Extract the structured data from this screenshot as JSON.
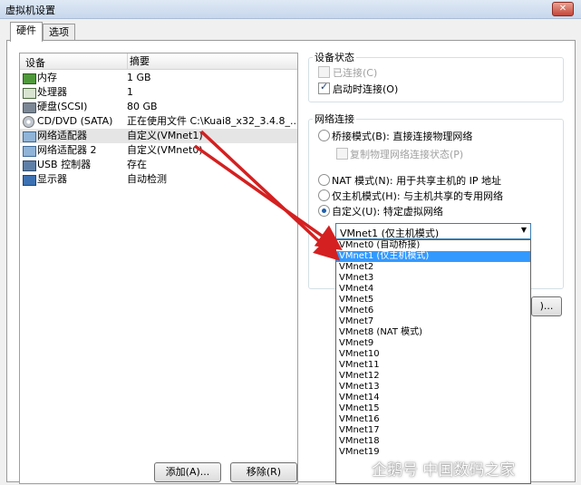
{
  "window": {
    "title": "虚拟机设置",
    "close_label": "✕"
  },
  "tabs": [
    {
      "label": "硬件"
    },
    {
      "label": "选项"
    }
  ],
  "device_list": {
    "col_device": "设备",
    "col_summary": "摘要",
    "rows": [
      {
        "icon": "memory-icon",
        "name": "内存",
        "summary": "1 GB"
      },
      {
        "icon": "processor-icon",
        "name": "处理器",
        "summary": "1"
      },
      {
        "icon": "hard-disk-icon",
        "name": "硬盘(SCSI)",
        "summary": "80 GB"
      },
      {
        "icon": "cd-dvd-icon",
        "name": "CD/DVD (SATA)",
        "summary": "正在使用文件 C:\\Kuai8_x32_3.4.8_..."
      },
      {
        "icon": "network-adapter-icon",
        "name": "网络适配器",
        "summary": "自定义(VMnet1)"
      },
      {
        "icon": "network-adapter-icon",
        "name": "网络适配器 2",
        "summary": "自定义(VMnet0)"
      },
      {
        "icon": "usb-icon",
        "name": "USB 控制器",
        "summary": "存在"
      },
      {
        "icon": "display-icon",
        "name": "显示器",
        "summary": "自动检测"
      }
    ],
    "add_button": "添加(A)...",
    "remove_button": "移除(R)"
  },
  "device_status": {
    "label": "设备状态",
    "connected": "已连接(C)",
    "connect_at_power_on": "启动时连接(O)"
  },
  "network_connection": {
    "label": "网络连接",
    "bridged": "桥接模式(B): 直接连接物理网络",
    "replicate": "复制物理网络连接状态(P)",
    "nat": "NAT 模式(N): 用于共享主机的 IP 地址",
    "host_only": "仅主机模式(H): 与主机共享的专用网络",
    "custom": "自定义(U): 特定虚拟网络",
    "selected": "VMnet1 (仅主机模式)",
    "options": [
      "VMnet0 (自动桥接)",
      "VMnet1 (仅主机模式)",
      "VMnet2",
      "VMnet3",
      "VMnet4",
      "VMnet5",
      "VMnet6",
      "VMnet7",
      "VMnet8 (NAT 模式)",
      "VMnet9",
      "VMnet10",
      "VMnet11",
      "VMnet12",
      "VMnet13",
      "VMnet14",
      "VMnet15",
      "VMnet16",
      "VMnet17",
      "VMnet18",
      "VMnet19"
    ],
    "highlighted_index": 1,
    "advanced_button": ")..."
  },
  "watermark": "企鹅号 中国数码之家",
  "colors": {
    "arrow": "#d42020",
    "highlight": "#3399ff"
  }
}
